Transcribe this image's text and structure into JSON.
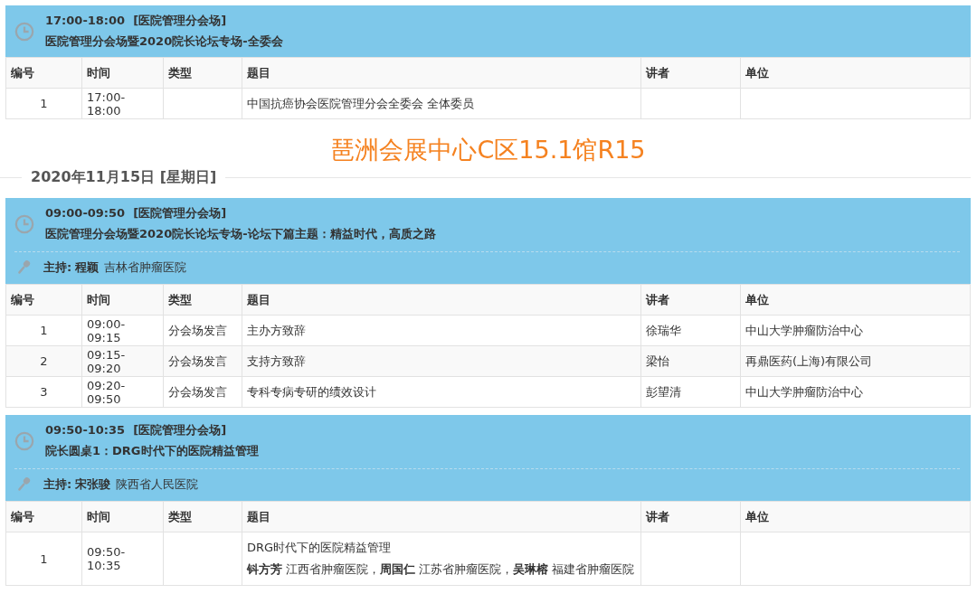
{
  "blocks": [
    {
      "kind": "session",
      "time": "17:00-18:00",
      "hall": "[医院管理分会场]",
      "title": "医院管理分会场暨2020院长论坛专场-全委会",
      "columns": [
        "编号",
        "时间",
        "类型",
        "题目",
        "讲者",
        "单位"
      ],
      "rows": [
        {
          "no": "1",
          "time": "17:00-18:00",
          "type": "",
          "topic": "中国抗癌协会医院管理分会全委会 全体委员",
          "speaker": "",
          "unit": ""
        }
      ]
    },
    {
      "kind": "venue",
      "text": "琶洲会展中心C区15.1馆R15"
    },
    {
      "kind": "date",
      "text": "2020年11月15日 [星期日]"
    },
    {
      "kind": "session",
      "time": "09:00-09:50",
      "hall": "[医院管理分会场]",
      "title": "医院管理分会场暨2020院长论坛专场-论坛下篇主题：精益时代，高质之路",
      "host": {
        "label": "主持:",
        "name": "程颖",
        "org": "吉林省肿瘤医院"
      },
      "columns": [
        "编号",
        "时间",
        "类型",
        "题目",
        "讲者",
        "单位"
      ],
      "rows": [
        {
          "no": "1",
          "time": "09:00-09:15",
          "type": "分会场发言",
          "topic": "主办方致辞",
          "speaker": "徐瑞华",
          "unit": "中山大学肿瘤防治中心"
        },
        {
          "no": "2",
          "time": "09:15-09:20",
          "type": "分会场发言",
          "topic": "支持方致辞",
          "speaker": "梁怡",
          "unit": "再鼎医药(上海)有限公司"
        },
        {
          "no": "3",
          "time": "09:20-09:50",
          "type": "分会场发言",
          "topic": "专科专病专研的绩效设计",
          "speaker": "彭望清",
          "unit": "中山大学肿瘤防治中心"
        }
      ]
    },
    {
      "kind": "session",
      "time": "09:50-10:35",
      "hall": "[医院管理分会场]",
      "title": "院长圆桌1：DRG时代下的医院精益管理",
      "host": {
        "label": "主持:",
        "name": "宋张骏",
        "org": "陕西省人民医院"
      },
      "columns": [
        "编号",
        "时间",
        "类型",
        "题目",
        "讲者",
        "单位"
      ],
      "rows": [
        {
          "no": "1",
          "time": "09:50-10:35",
          "type": "",
          "topic": "DRG时代下的医院精益管理",
          "detail": "**钭方芳** 江西省肿瘤医院，**周国仁** 江苏省肿瘤医院，**吴琳榕** 福建省肿瘤医院",
          "speaker": "",
          "unit": ""
        }
      ]
    }
  ]
}
